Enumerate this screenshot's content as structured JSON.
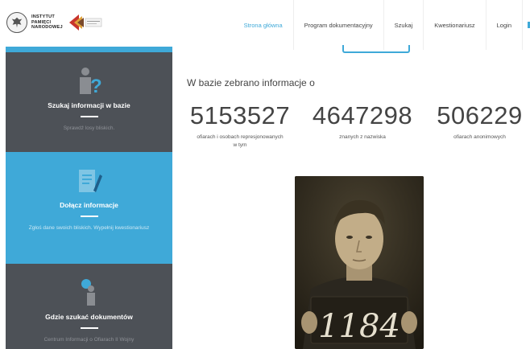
{
  "header": {
    "logo_text_lines": [
      "INSTYTUT",
      "PAMIĘCI",
      "NARODOWEJ"
    ],
    "nav": [
      {
        "label": "Strona główna",
        "active": true
      },
      {
        "label": "Program dokumentacyjny",
        "active": false
      },
      {
        "label": "Szukaj",
        "active": false
      },
      {
        "label": "Kwestionariusz",
        "active": false
      },
      {
        "label": "Login",
        "active": false
      }
    ]
  },
  "sidebar": {
    "panels": [
      {
        "title": "Szukaj informacji w bazie",
        "desc": "Sprawdź losy bliskich.",
        "icon": "person-search-icon"
      },
      {
        "title": "Dołącz informacje",
        "desc": "Zgłoś dane swoich bliskich. Wypełnij kwestionariusz",
        "icon": "document-pen-icon"
      },
      {
        "title": "Gdzie szukać dokumentów",
        "desc": "Centrum Informacji o Ofiarach II Wojny",
        "icon": "person-info-icon"
      }
    ]
  },
  "main": {
    "intro": "W bazie zebrano informacje o",
    "stats": [
      {
        "value": "5153527",
        "label_line1": "ofiarach i osobach represjonowanych",
        "label_line2": "w tym"
      },
      {
        "value": "4647298",
        "label_line1": "znanych z nazwiska",
        "label_line2": ""
      },
      {
        "value": "506229",
        "label_line1": "ofiarach anonimowych",
        "label_line2": ""
      }
    ],
    "photo_sign_number": "1184"
  },
  "colors": {
    "accent": "#3fa9d8",
    "sidebar_dark": "#4d5157",
    "text": "#444444"
  }
}
